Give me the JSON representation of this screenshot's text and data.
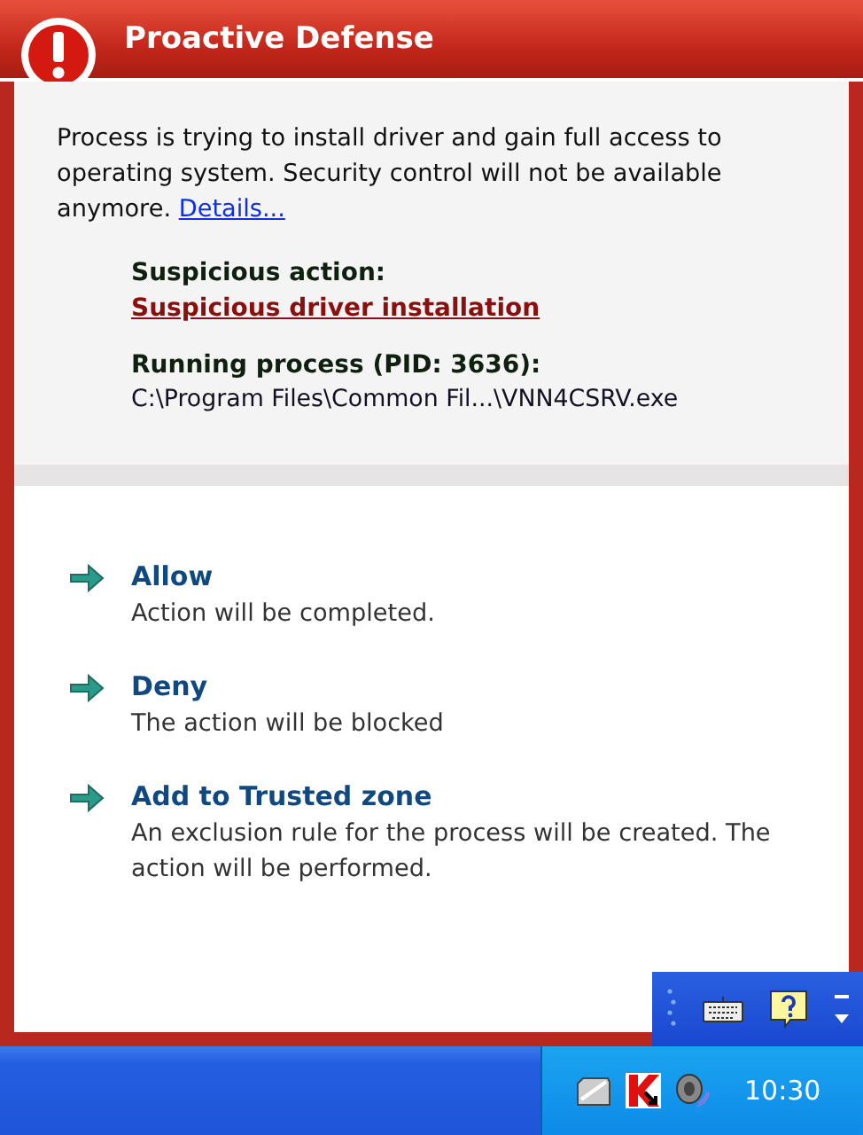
{
  "window": {
    "title": "Proactive Defense"
  },
  "message": {
    "text": "Process is trying to install driver and gain full access to operating system. Security control will not be available anymore.",
    "link": "Details..."
  },
  "details": [
    {
      "kind": "link",
      "label": "Suspicious action:",
      "value": "Suspicious driver installation"
    },
    {
      "kind": "path",
      "label": "Running process (PID: 3636):",
      "value": "C:\\Program Files\\Common Fil...\\VNN4CSRV.exe"
    }
  ],
  "actions": [
    {
      "label": "Allow",
      "description": "Action will be completed."
    },
    {
      "label": "Deny",
      "description": "The action will be blocked"
    },
    {
      "label": "Add to Trusted zone",
      "description": "An exclusion rule for the process will be created. The action will be performed."
    }
  ],
  "taskbar": {
    "clock": "10:30"
  }
}
